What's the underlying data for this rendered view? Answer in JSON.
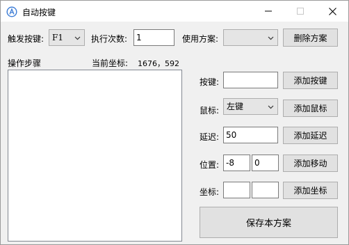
{
  "window": {
    "title": "自动按键"
  },
  "toolbar": {
    "trigger_label": "触发按键:",
    "trigger_value": "F1",
    "count_label": "执行次数:",
    "count_value": "1",
    "scheme_label": "使用方案:",
    "scheme_value": "",
    "delete_scheme_label": "删除方案"
  },
  "steps": {
    "label": "操作步骤",
    "coord_label": "当前坐标:",
    "coord_value": "1676，592"
  },
  "form": {
    "key_label": "按键:",
    "key_value": "",
    "add_key_label": "添加按键",
    "mouse_label": "鼠标:",
    "mouse_value": "左键",
    "add_mouse_label": "添加鼠标",
    "delay_label": "延迟:",
    "delay_value": "50",
    "add_delay_label": "添加延迟",
    "position_label": "位置:",
    "position_x": "-8",
    "position_y": "0",
    "add_move_label": "添加移动",
    "coord_label": "坐标:",
    "coord_x": "",
    "coord_y": "",
    "add_coord_label": "添加坐标",
    "save_label": "保存本方案"
  }
}
